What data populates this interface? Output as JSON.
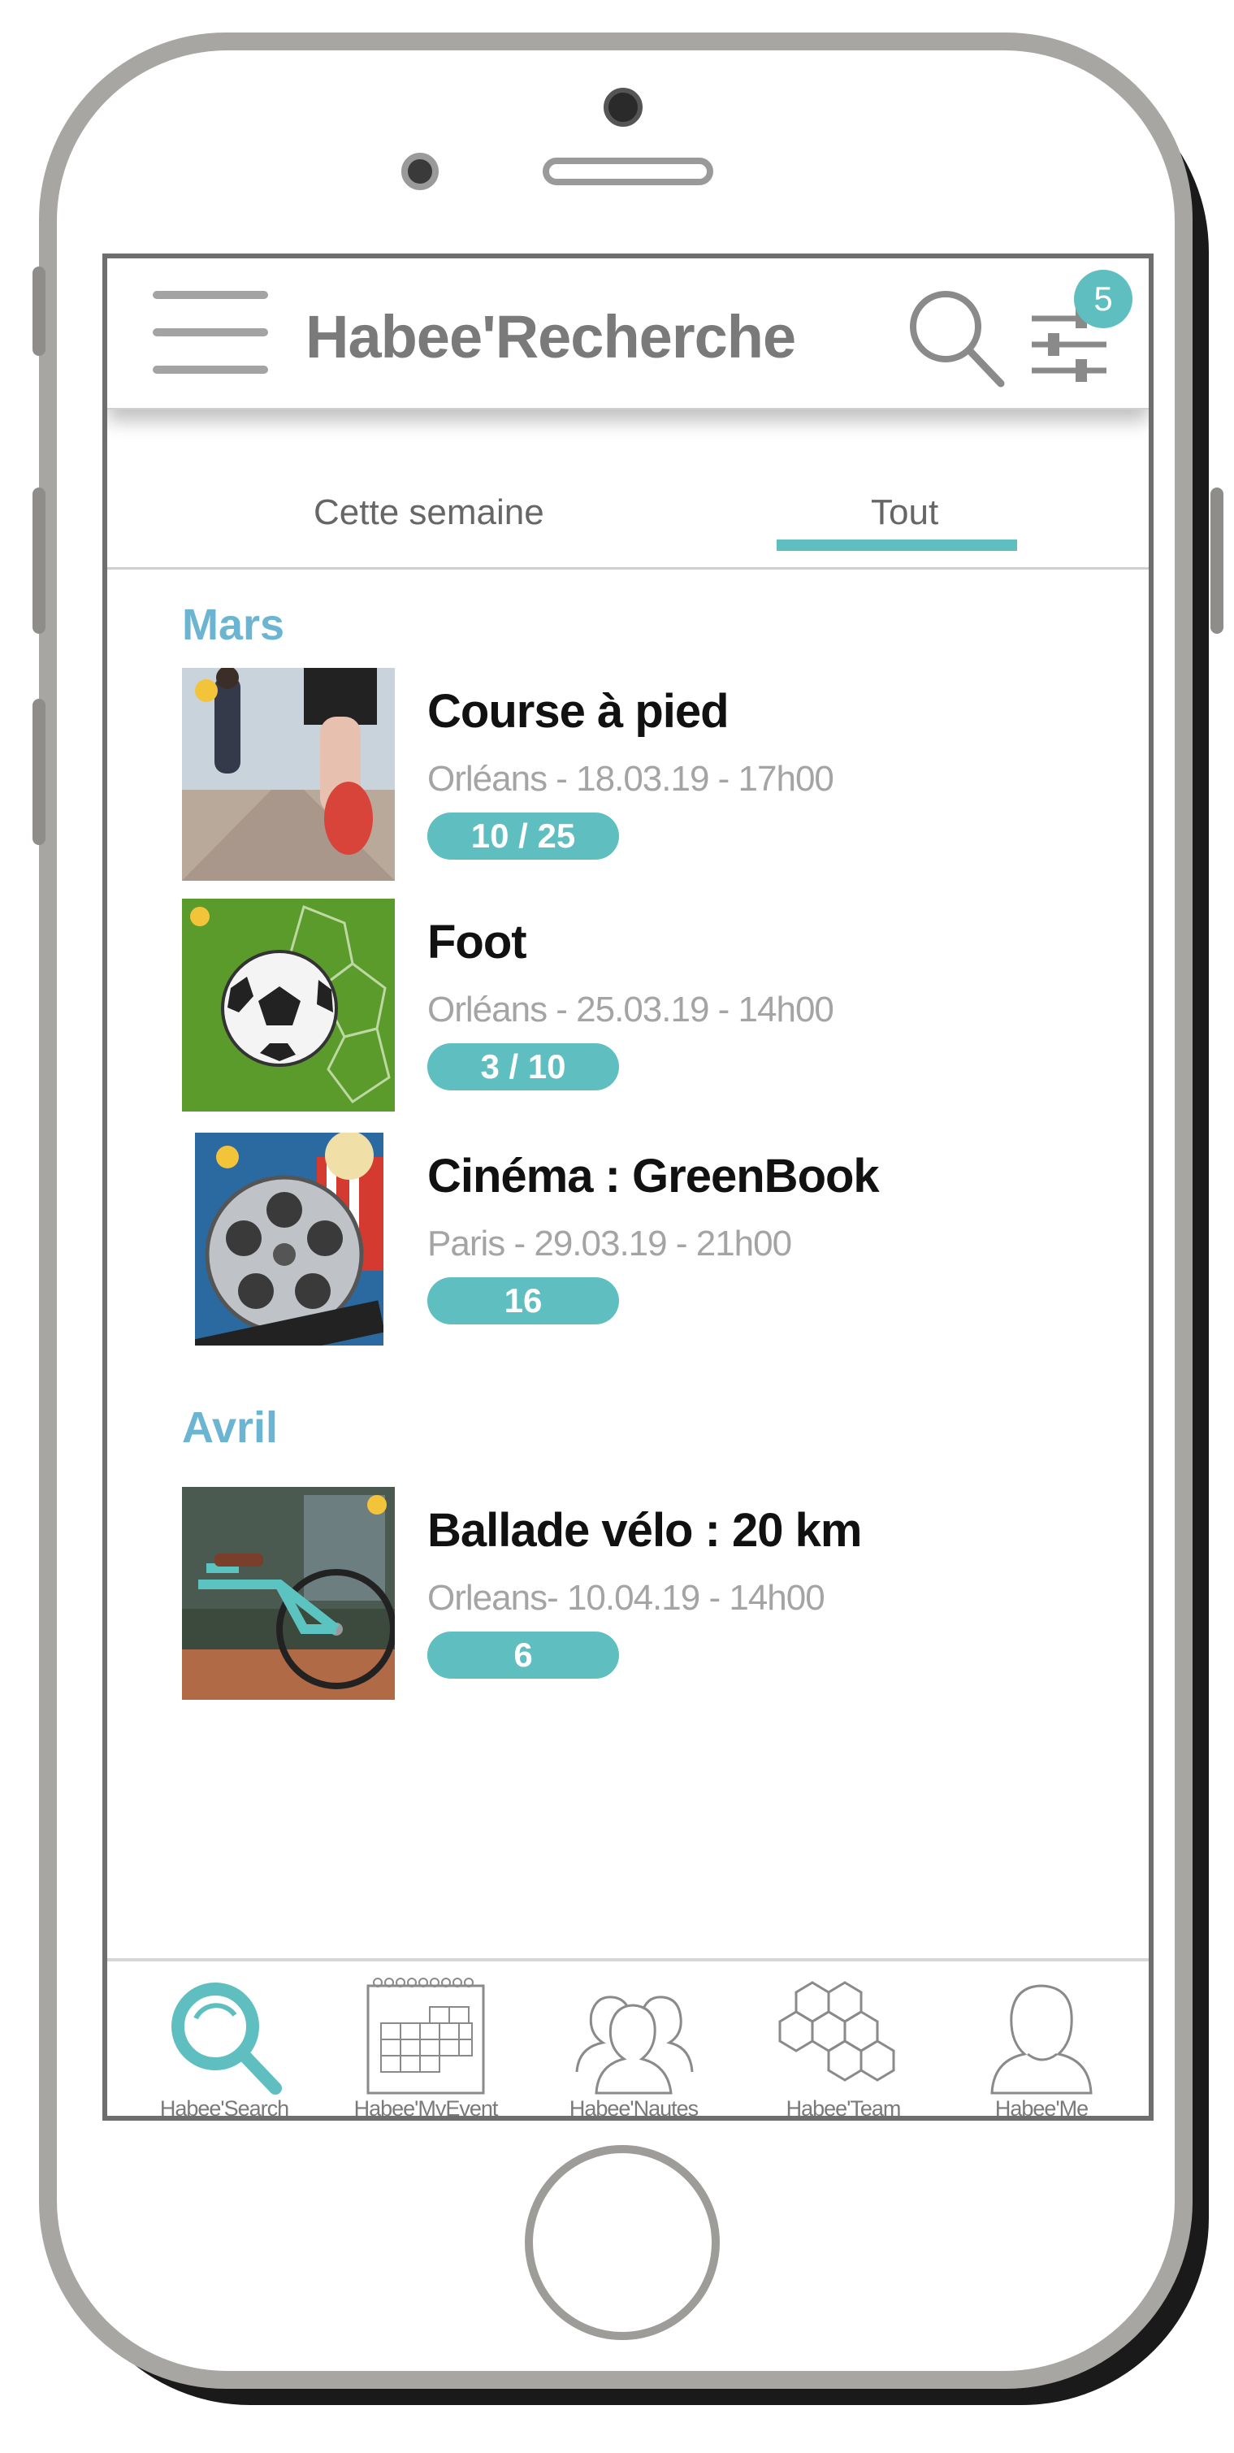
{
  "header": {
    "title": "Habee'Recherche",
    "filter_badge": "5"
  },
  "tabs": [
    {
      "label": "Cette semaine",
      "active": false
    },
    {
      "label": "Tout",
      "active": true
    }
  ],
  "sections": [
    {
      "month": "Mars",
      "events": [
        {
          "title": "Course à pied",
          "meta": "Orléans - 18.03.19 - 17h00",
          "count": "10 / 25",
          "image": "running-photo"
        },
        {
          "title": "Foot",
          "meta": "Orléans - 25.03.19 - 14h00",
          "count": "3 / 10",
          "image": "soccer-ball-photo"
        },
        {
          "title": "Cinéma : GreenBook",
          "meta": "Paris - 29.03.19 - 21h00",
          "count": "16",
          "image": "cinema-reel-photo"
        }
      ]
    },
    {
      "month": "Avril",
      "events": [
        {
          "title": "Ballade vélo : 20 km",
          "meta": "Orleans- 10.04.19 - 14h00",
          "count": "6",
          "image": "bicycle-photo"
        }
      ]
    }
  ],
  "bottom_nav": [
    {
      "label": "Habee'Search",
      "icon": "search-icon",
      "active": true
    },
    {
      "label": "Habee'MyEvent",
      "icon": "calendar-icon",
      "active": false
    },
    {
      "label": "Habee'Nautes",
      "icon": "people-icon",
      "active": false
    },
    {
      "label": "Habee'Team",
      "icon": "hexagons-icon",
      "active": false
    },
    {
      "label": "Habee'Me",
      "icon": "user-icon",
      "active": false
    }
  ],
  "colors": {
    "accent": "#5fbec0",
    "month": "#6cb5d2",
    "title_gray": "#7a7a7a"
  }
}
